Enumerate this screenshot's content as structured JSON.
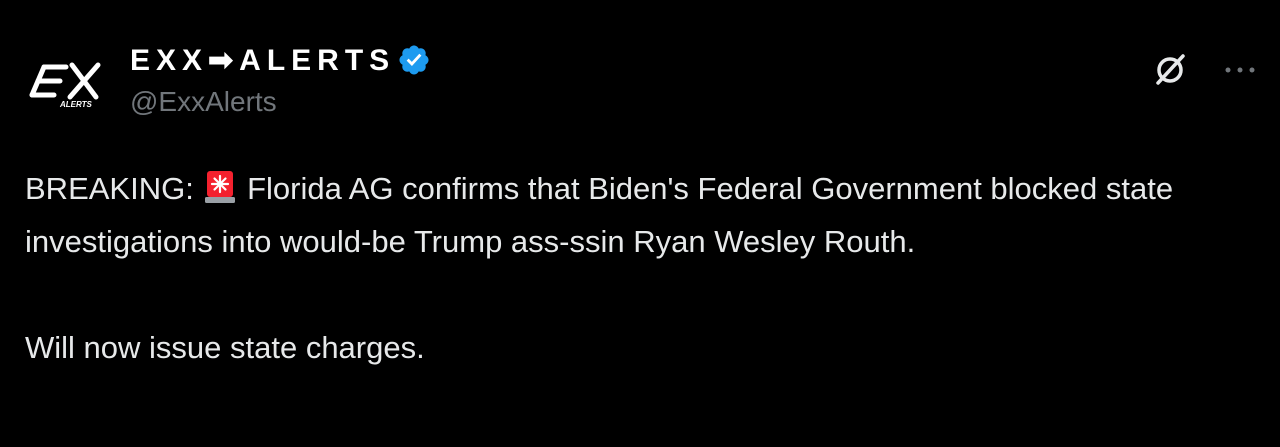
{
  "author": {
    "display_name": "EXX➡ALERTS",
    "handle": "@ExxAlerts",
    "avatar_label": "EX",
    "avatar_sublabel": "ALERTS",
    "verified": true
  },
  "post": {
    "line1_prefix": "BREAKING:",
    "emoji": "rotating-light-icon",
    "line1_rest": "Florida AG confirms that Biden's Federal Government blocked state investigations into would-be Trump ass-ssin Ryan Wesley Routh.",
    "line2": "Will now issue state charges."
  },
  "colors": {
    "background": "#000000",
    "text": "#e7e9ea",
    "secondary": "#71767b",
    "verified_blue": "#1d9bf0",
    "siren_red": "#f4212e"
  }
}
